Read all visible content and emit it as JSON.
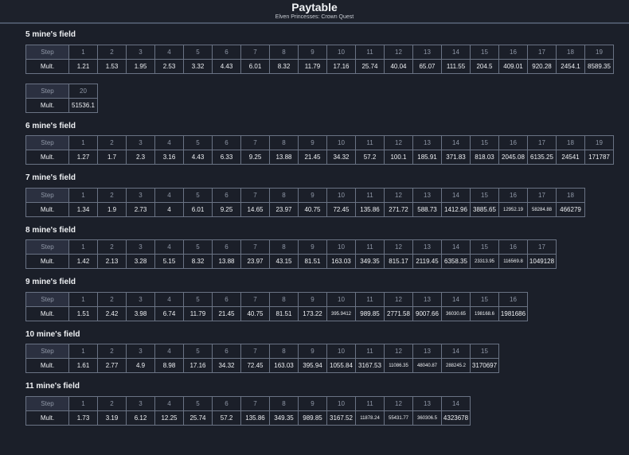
{
  "header": {
    "title": "Paytable",
    "subtitle": "Elven Princesses: Crown Quest"
  },
  "labels": {
    "step": "Step",
    "mult": "Mult."
  },
  "sections": [
    {
      "title": "5 mine's field",
      "tables": [
        {
          "steps": [
            "1",
            "2",
            "3",
            "4",
            "5",
            "6",
            "7",
            "8",
            "9",
            "10",
            "11",
            "12",
            "13",
            "14",
            "15",
            "16",
            "17",
            "18",
            "19"
          ],
          "mults": [
            "1.21",
            "1.53",
            "1.95",
            "2.53",
            "3.32",
            "4.43",
            "6.01",
            "8.32",
            "11.79",
            "17.16",
            "25.74",
            "40.04",
            "65.07",
            "111.55",
            "204.5",
            "409.01",
            "920.28",
            "2454.1",
            "8589.35"
          ]
        },
        {
          "steps": [
            "20"
          ],
          "mults": [
            "51536.1"
          ]
        }
      ]
    },
    {
      "title": "6 mine's field",
      "tables": [
        {
          "steps": [
            "1",
            "2",
            "3",
            "4",
            "5",
            "6",
            "7",
            "8",
            "9",
            "10",
            "11",
            "12",
            "13",
            "14",
            "15",
            "16",
            "17",
            "18",
            "19"
          ],
          "mults": [
            "1.27",
            "1.7",
            "2.3",
            "3.16",
            "4.43",
            "6.33",
            "9.25",
            "13.88",
            "21.45",
            "34.32",
            "57.2",
            "100.1",
            "185.91",
            "371.83",
            "818.03",
            "2045.08",
            "6135.25",
            "24541",
            "171787"
          ]
        }
      ]
    },
    {
      "title": "7 mine's field",
      "tables": [
        {
          "steps": [
            "1",
            "2",
            "3",
            "4",
            "5",
            "6",
            "7",
            "8",
            "9",
            "10",
            "11",
            "12",
            "13",
            "14",
            "15",
            "16",
            "17",
            "18"
          ],
          "mults": [
            "1.34",
            "1.9",
            "2.73",
            "4",
            "6.01",
            "9.25",
            "14.65",
            "23.97",
            "40.75",
            "72.45",
            "135.86",
            "271.72",
            "588.73",
            "1412.96",
            "3885.65",
            "12952.19",
            "58284.88",
            "466279"
          ]
        }
      ]
    },
    {
      "title": "8 mine's field",
      "tables": [
        {
          "steps": [
            "1",
            "2",
            "3",
            "4",
            "5",
            "6",
            "7",
            "8",
            "9",
            "10",
            "11",
            "12",
            "13",
            "14",
            "15",
            "16",
            "17"
          ],
          "mults": [
            "1.42",
            "2.13",
            "3.28",
            "5.15",
            "8.32",
            "13.88",
            "23.97",
            "43.15",
            "81.51",
            "163.03",
            "349.35",
            "815.17",
            "2119.45",
            "6358.35",
            "23313.95",
            "116569.8",
            "1049128"
          ]
        }
      ]
    },
    {
      "title": "9 mine's field",
      "tables": [
        {
          "steps": [
            "1",
            "2",
            "3",
            "4",
            "5",
            "6",
            "7",
            "8",
            "9",
            "10",
            "11",
            "12",
            "13",
            "14",
            "15",
            "16"
          ],
          "mults": [
            "1.51",
            "2.42",
            "3.98",
            "6.74",
            "11.79",
            "21.45",
            "40.75",
            "81.51",
            "173.22",
            "395.9412",
            "989.85",
            "2771.58",
            "9007.66",
            "36030.65",
            "198168.6",
            "1981686"
          ]
        }
      ]
    },
    {
      "title": "10 mine's field",
      "tables": [
        {
          "steps": [
            "1",
            "2",
            "3",
            "4",
            "5",
            "6",
            "7",
            "8",
            "9",
            "10",
            "11",
            "12",
            "13",
            "14",
            "15"
          ],
          "mults": [
            "1.61",
            "2.77",
            "4.9",
            "8.98",
            "17.16",
            "34.32",
            "72.45",
            "163.03",
            "395.94",
            "1055.84",
            "3167.53",
            "11086.35",
            "48040.87",
            "288245.2",
            "3170697"
          ]
        }
      ]
    },
    {
      "title": "11 mine's field",
      "tables": [
        {
          "steps": [
            "1",
            "2",
            "3",
            "4",
            "5",
            "6",
            "7",
            "8",
            "9",
            "10",
            "11",
            "12",
            "13",
            "14"
          ],
          "mults": [
            "1.73",
            "3.19",
            "6.12",
            "12.25",
            "25.74",
            "57.2",
            "135.86",
            "349.35",
            "989.85",
            "3167.52",
            "11878.24",
            "55431.77",
            "360306.5",
            "4323678"
          ]
        }
      ]
    }
  ]
}
